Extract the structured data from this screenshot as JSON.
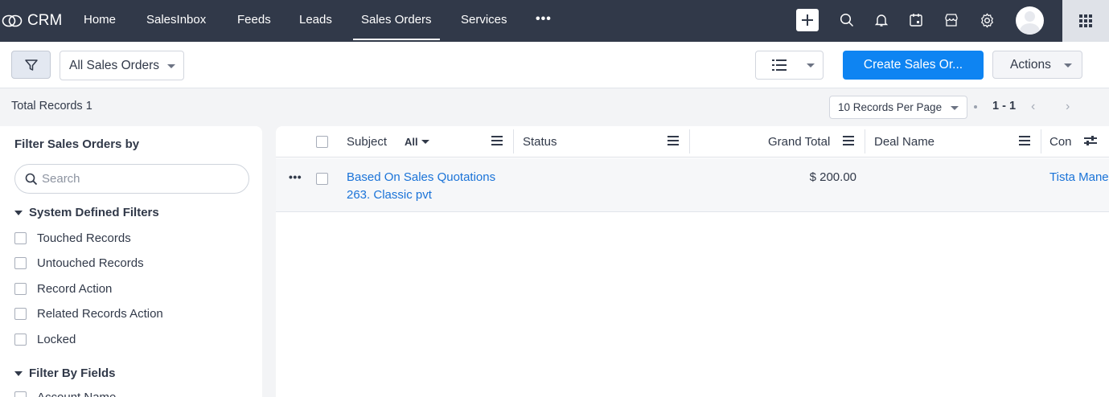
{
  "nav": {
    "brand": "CRM",
    "items": [
      {
        "label": "Home"
      },
      {
        "label": "SalesInbox"
      },
      {
        "label": "Feeds"
      },
      {
        "label": "Leads"
      },
      {
        "label": "Sales Orders"
      },
      {
        "label": "Services"
      }
    ],
    "more": "•••",
    "active": "Sales Orders"
  },
  "toolbar": {
    "view": "All Sales Orders",
    "create_label": "Create Sales Or...",
    "actions_label": "Actions"
  },
  "records": {
    "total_label": "Total Records",
    "total": "1",
    "per_page": "10 Records Per Page",
    "range": "1 - 1",
    "prev": "‹",
    "next": "›"
  },
  "filter_panel": {
    "title": "Filter Sales Orders by",
    "search_placeholder": "Search",
    "system_section": "System Defined Filters",
    "system_filters": [
      "Touched Records",
      "Untouched Records",
      "Record Action",
      "Related Records Action",
      "Locked"
    ],
    "fields_section": "Filter By Fields",
    "field_filters": [
      "Account Name"
    ]
  },
  "grid": {
    "columns": {
      "subject": "Subject",
      "subject_filter": "All",
      "status": "Status",
      "grand_total": "Grand Total",
      "deal_name": "Deal Name",
      "contact": "Con"
    },
    "rows": [
      {
        "subject_line1": "Based On Sales Quotations",
        "subject_line2": "263. Classic pvt",
        "status": "",
        "grand_total": "$ 200.00",
        "deal_name": "",
        "contact": "Tista Manel"
      }
    ]
  },
  "colors": {
    "nav_bg": "#313949",
    "primary": "#0e84f2",
    "link": "#1a73d8",
    "page_bg": "#f3f4f6"
  },
  "icons": [
    "crm-logo-icon",
    "plus-icon",
    "search-icon",
    "bell-icon",
    "calendar-icon",
    "marketplace-icon",
    "gear-icon",
    "avatar",
    "apps-grid-icon",
    "filter-icon",
    "list-view-icon",
    "column-settings-icon"
  ]
}
